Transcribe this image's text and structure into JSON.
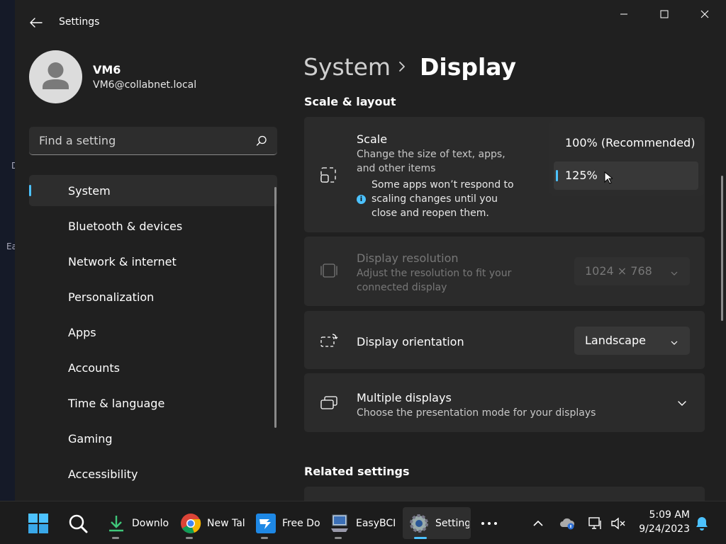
{
  "desktop": {
    "fragments": [
      "D",
      "Ea"
    ]
  },
  "window": {
    "title": "Settings",
    "controls": {
      "minimize": "minimize",
      "maximize": "maximize",
      "close": "close"
    }
  },
  "profile": {
    "name": "VM6",
    "email": "VM6@collabnet.local"
  },
  "search": {
    "placeholder": "Find a setting"
  },
  "nav": {
    "selected": "System",
    "items": [
      {
        "label": "System"
      },
      {
        "label": "Bluetooth & devices"
      },
      {
        "label": "Network & internet"
      },
      {
        "label": "Personalization"
      },
      {
        "label": "Apps"
      },
      {
        "label": "Accounts"
      },
      {
        "label": "Time & language"
      },
      {
        "label": "Gaming"
      },
      {
        "label": "Accessibility"
      }
    ]
  },
  "breadcrumb": {
    "parent": "System",
    "current": "Display"
  },
  "sections": {
    "scale_layout": "Scale & layout",
    "related": "Related settings"
  },
  "cards": {
    "scale": {
      "title": "Scale",
      "subtitle": "Change the size of text, apps, and other items",
      "warning": "Some apps won’t respond to scaling changes until you close and reopen them.",
      "options": [
        "100% (Recommended)",
        "125%"
      ],
      "selected": "125%"
    },
    "resolution": {
      "title": "Display resolution",
      "subtitle": "Adjust the resolution to fit your connected display",
      "value": "1024 × 768"
    },
    "orientation": {
      "title": "Display orientation",
      "value": "Landscape"
    },
    "multiple": {
      "title": "Multiple displays",
      "subtitle": "Choose the presentation mode for your displays"
    }
  },
  "taskbar": {
    "apps": [
      {
        "label": "Downlo"
      },
      {
        "label": "New Tal"
      },
      {
        "label": "Free Do"
      },
      {
        "label": "EasyBCI"
      },
      {
        "label": "Setting"
      }
    ],
    "clock": {
      "time": "5:09 AM",
      "date": "9/24/2023"
    }
  },
  "colors": {
    "accent": "#4cc2ff",
    "window_bg": "#202020",
    "card_bg": "#2b2b2b"
  }
}
